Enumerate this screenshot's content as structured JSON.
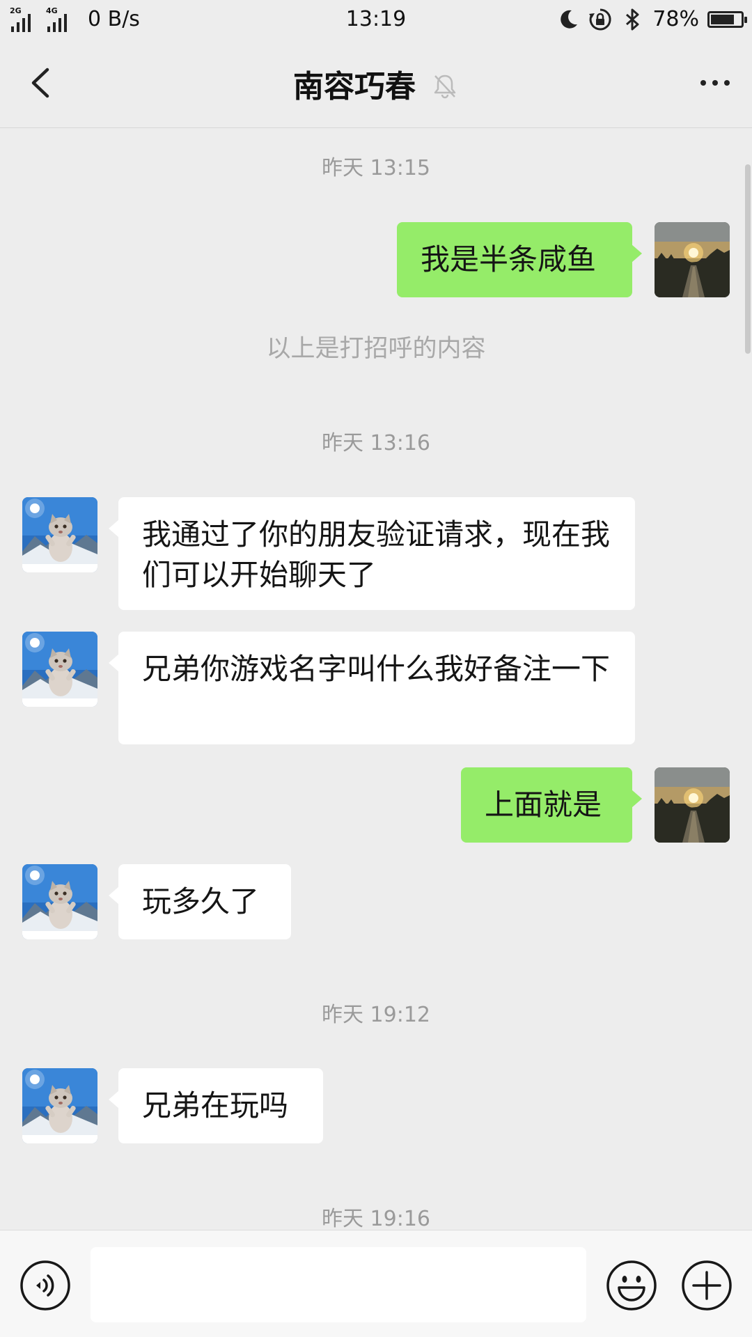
{
  "status_bar": {
    "sim1_label": "2G",
    "sim2_label": "4G",
    "net_speed": "0 B/s",
    "time": "13:19",
    "battery_percent": "78%",
    "battery_level": 0.78,
    "icons": [
      "moon-icon",
      "rotation-lock-icon",
      "bluetooth-icon"
    ]
  },
  "header": {
    "back_icon": "chevron-left-icon",
    "title": "南容巧春",
    "mute_icon": "bell-off-icon",
    "more_icon": "more-dots-icon"
  },
  "chat": {
    "timestamps": [
      "昨天 13:15",
      "昨天 13:16",
      "昨天 19:12",
      "昨天 19:16"
    ],
    "system_notice": "以上是打招呼的内容",
    "messages": [
      {
        "from": "me",
        "text": "我是半条咸鱼"
      },
      {
        "from": "other",
        "text": "我通过了你的朋友验证请求，现在我们可以开始聊天了"
      },
      {
        "from": "other",
        "text": "兄弟你游戏名字叫什么我好备注一下"
      },
      {
        "from": "me",
        "text": "上面就是"
      },
      {
        "from": "other",
        "text": "玩多久了"
      },
      {
        "from": "other",
        "text": "兄弟在玩吗"
      }
    ],
    "bubble_colors": {
      "me": "#95ec69",
      "other": "#ffffff"
    }
  },
  "input_bar": {
    "voice_icon": "voice-icon",
    "text_value": "",
    "emoji_icon": "emoji-icon",
    "plus_icon": "plus-icon"
  }
}
